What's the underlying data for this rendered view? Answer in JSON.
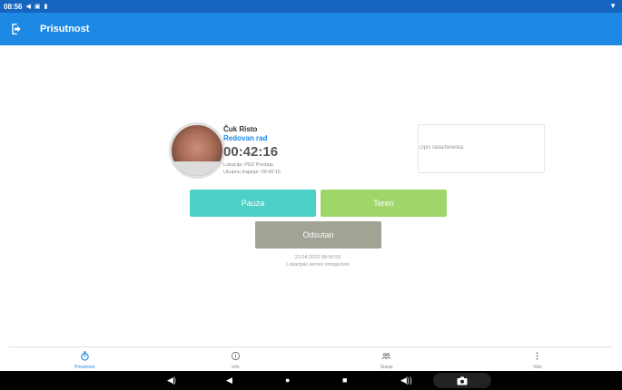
{
  "status_bar": {
    "time": "08:56"
  },
  "app_bar": {
    "title": "Prisutnost"
  },
  "profile": {
    "name": "Čuk Risto",
    "work_type": "Redovan rad",
    "timer": "00:42:16",
    "location": "Lokacija: PDZ Prodaja",
    "total_duration": "Ukupno trajanje: 00:42:16"
  },
  "note": {
    "placeholder": "Opis rada/beleška"
  },
  "buttons": {
    "pause": "Pauza",
    "field": "Teren",
    "absent": "Odsutan"
  },
  "stamp": {
    "datetime": "23.04.2025 08:56:53",
    "location_status": "Lokacijski servisi omogućeni"
  },
  "bottom_nav": {
    "items": [
      {
        "label": "Prisutnost",
        "icon": "stopwatch-icon",
        "active": true
      },
      {
        "label": "Info",
        "icon": "info-icon",
        "active": false
      },
      {
        "label": "Stanje",
        "icon": "people-icon",
        "active": false
      },
      {
        "label": "Više",
        "icon": "more-vertical-icon",
        "active": false
      }
    ]
  },
  "colors": {
    "status_bar": "#1565c0",
    "app_bar": "#1e88e5",
    "accent": "#1e88e5",
    "pause": "#4dd0c6",
    "field": "#9ed66a",
    "absent": "#a0a494"
  }
}
